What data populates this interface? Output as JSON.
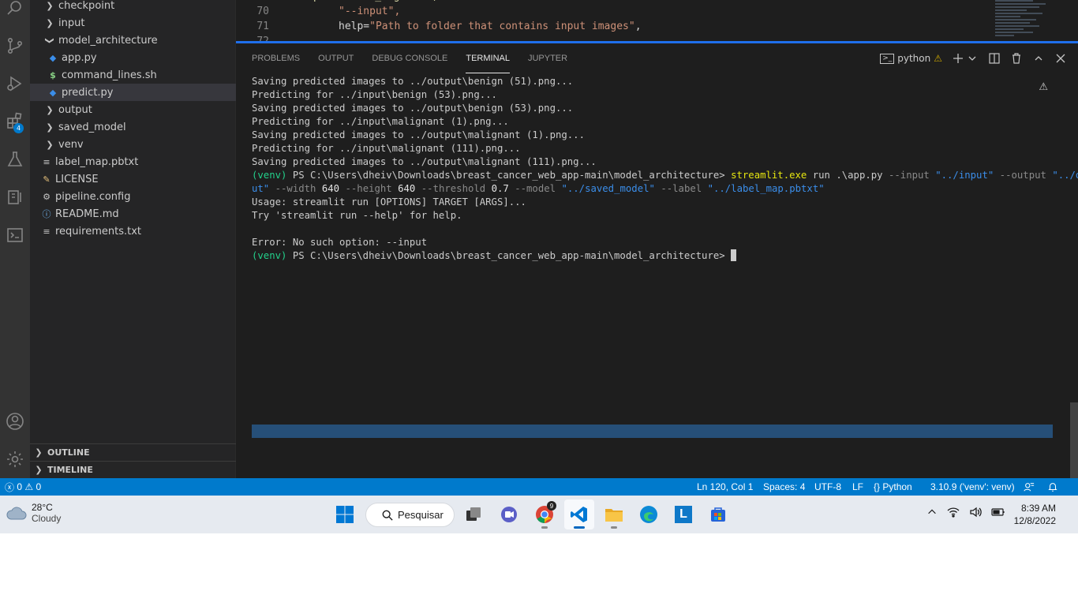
{
  "explorer": {
    "items": [
      {
        "label": "checkpoint",
        "kind": "folder"
      },
      {
        "label": "input",
        "kind": "folder"
      },
      {
        "label": "model_architecture",
        "kind": "folder-open"
      },
      {
        "label": "app.py",
        "kind": "python"
      },
      {
        "label": "command_lines.sh",
        "kind": "shell"
      },
      {
        "label": "predict.py",
        "kind": "python"
      },
      {
        "label": "output",
        "kind": "folder"
      },
      {
        "label": "saved_model",
        "kind": "folder"
      },
      {
        "label": "venv",
        "kind": "folder"
      },
      {
        "label": "label_map.pbtxt",
        "kind": "text"
      },
      {
        "label": "LICENSE",
        "kind": "license"
      },
      {
        "label": "pipeline.config",
        "kind": "config"
      },
      {
        "label": "README.md",
        "kind": "info"
      },
      {
        "label": "requirements.txt",
        "kind": "text"
      }
    ],
    "outline_label": "OUTLINE",
    "timeline_label": "TIMELINE"
  },
  "activity": {
    "extensions_badge": "4"
  },
  "editor": {
    "lines": [
      {
        "num": "70",
        "text": "\"--input\","
      },
      {
        "num": "71",
        "text_prefix": "help=",
        "text_str": "\"Path to folder that contains input images\"",
        "text_suffix": ","
      }
    ]
  },
  "panel": {
    "tabs": [
      "PROBLEMS",
      "OUTPUT",
      "DEBUG CONSOLE",
      "TERMINAL",
      "JUPYTER"
    ],
    "active_tab": "TERMINAL",
    "terminal_name": "python"
  },
  "terminal": {
    "lines": [
      "Saving predicted images to ../output\\benign (51).png...",
      "Predicting for ../input\\benign (53).png...",
      "Saving predicted images to ../output\\benign (53).png...",
      "Predicting for ../input\\malignant (1).png...",
      "Saving predicted images to ../output\\malignant (1).png...",
      "Predicting for ../input\\malignant (111).png...",
      "Saving predicted images to ../output\\malignant (111).png..."
    ],
    "venv": "(venv)",
    "prompt": " PS C:\\Users\\dheiv\\Downloads\\breast_cancer_web_app-main\\model_architecture> ",
    "command": "streamlit.exe",
    "cmd_run": " run .\\app.py ",
    "flag_input": "--input",
    "val_input": "\"../input\"",
    "flag_output": "--output",
    "val_output_a": "\"../outp",
    "val_output_b": "ut\"",
    "flag_width": "--width",
    "val_width": "640",
    "flag_height": "--height",
    "val_height": "640",
    "flag_threshold": "--threshold",
    "val_threshold": "0.7",
    "flag_model": "--model",
    "val_model": "\"../saved_model\"",
    "flag_label": "--label",
    "val_label": "\"../label_map.pbtxt\"",
    "usage": "Usage: streamlit run [OPTIONS] TARGET [ARGS]...",
    "try": "Try 'streamlit run --help' for help.",
    "error": "Error: No such option: --input"
  },
  "status": {
    "errors": "0",
    "warnings": "0",
    "position": "Ln 120, Col 1",
    "spaces": "Spaces: 4",
    "encoding": "UTF-8",
    "eol": "LF",
    "language": "Python",
    "interpreter": "3.10.9 ('venv': venv)"
  },
  "taskbar": {
    "temperature": "28°C",
    "weather": "Cloudy",
    "search_label": "Pesquisar",
    "time": "8:39 AM",
    "date": "12/8/2022",
    "chrome_badge": "9"
  },
  "colors": {
    "accent": "#007acc",
    "terminal_green": "#23d18b",
    "terminal_yellow": "#e5e510",
    "terminal_blue": "#3b8eea"
  }
}
